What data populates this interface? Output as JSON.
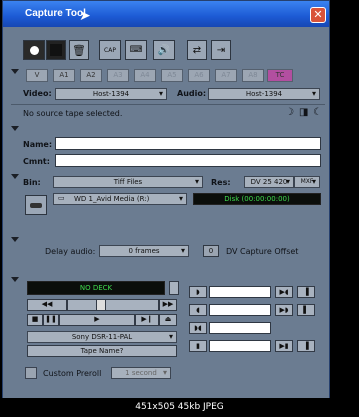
{
  "window": {
    "title": "Capture Tool",
    "close_label": "✕"
  },
  "toolbar": {
    "icons": [
      "record-icon",
      "stop-icon",
      "trash-icon",
      "capture-icon",
      "keyboard-icon",
      "speaker-icon",
      "toggle-icon",
      "arrow-icon"
    ]
  },
  "tracks": [
    "V",
    "A1",
    "A2",
    "A3",
    "A4",
    "A5",
    "A6",
    "A7",
    "A8",
    "TC"
  ],
  "io": {
    "video_label": "Video:",
    "video_value": "Host-1394",
    "audio_label": "Audio:",
    "audio_value": "Host-1394",
    "status": "No source tape selected."
  },
  "info": {
    "name_label": "Name:",
    "cmnt_label": "Cmnt:"
  },
  "bin": {
    "bin_label": "Bin:",
    "bin_value": "Tiff Files",
    "res_label": "Res:",
    "res_value": "DV 25 420",
    "res_extra": "MXF",
    "drive_value": "WD 1_Avid Media (R:)",
    "disk_readout": "Disk (00:00:00:00)"
  },
  "delay": {
    "label": "Delay audio:",
    "value": "0 frames",
    "offset_value": "0",
    "offset_label": "DV Capture Offset"
  },
  "deck": {
    "display": "NO DECK",
    "model": "Sony DSR-11-PAL",
    "tape_button": "Tape Name?"
  },
  "preroll": {
    "label": "Custom Preroll",
    "value": "1 second"
  },
  "footer": {
    "text": "451x505 45kb JPEG"
  }
}
